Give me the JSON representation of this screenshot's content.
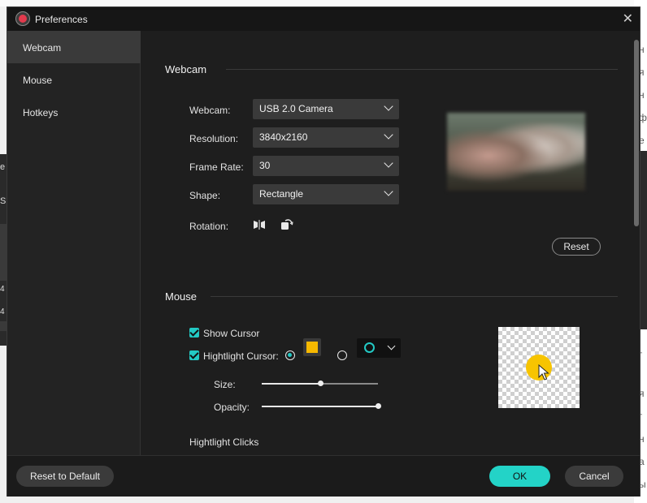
{
  "window": {
    "title": "Preferences"
  },
  "sidebar": {
    "items": [
      {
        "label": "Webcam",
        "active": true
      },
      {
        "label": "Mouse",
        "active": false
      },
      {
        "label": "Hotkeys",
        "active": false
      }
    ]
  },
  "webcam": {
    "heading": "Webcam",
    "fields": [
      {
        "label": "Webcam:",
        "value": "USB 2.0 Camera"
      },
      {
        "label": "Resolution:",
        "value": "3840x2160"
      },
      {
        "label": "Frame Rate:",
        "value": "30"
      },
      {
        "label": "Shape:",
        "value": "Rectangle"
      }
    ],
    "rotation_label": "Rotation:",
    "reset_label": "Reset"
  },
  "mouse": {
    "heading": "Mouse",
    "show_cursor_label": "Show Cursor",
    "show_cursor_checked": true,
    "highlight_cursor_label": "Hightlight Cursor:",
    "highlight_cursor_checked": true,
    "highlight_style": "filled-square-selected",
    "highlight_color": "#f7b900",
    "ring_color": "#23c9c4",
    "size_label": "Size:",
    "size_value": 0.5,
    "opacity_label": "Opacity:",
    "opacity_value": 1.0,
    "highlight_clicks_label": "Hightlight Clicks"
  },
  "background": {
    "left_fragments": [
      "e",
      "S",
      "4",
      "4"
    ],
    "right_fragments": [
      "н",
      "я",
      "н",
      "ф",
      "е",
      "г",
      "я",
      "г",
      "н",
      "а",
      "ы"
    ]
  },
  "footer": {
    "reset_default_label": "Reset to Default",
    "ok_label": "OK",
    "cancel_label": "Cancel"
  },
  "colors": {
    "accent": "#23d3c7",
    "dialog_bg": "#1e1e1e",
    "sidebar_active": "#3a3a3a"
  }
}
